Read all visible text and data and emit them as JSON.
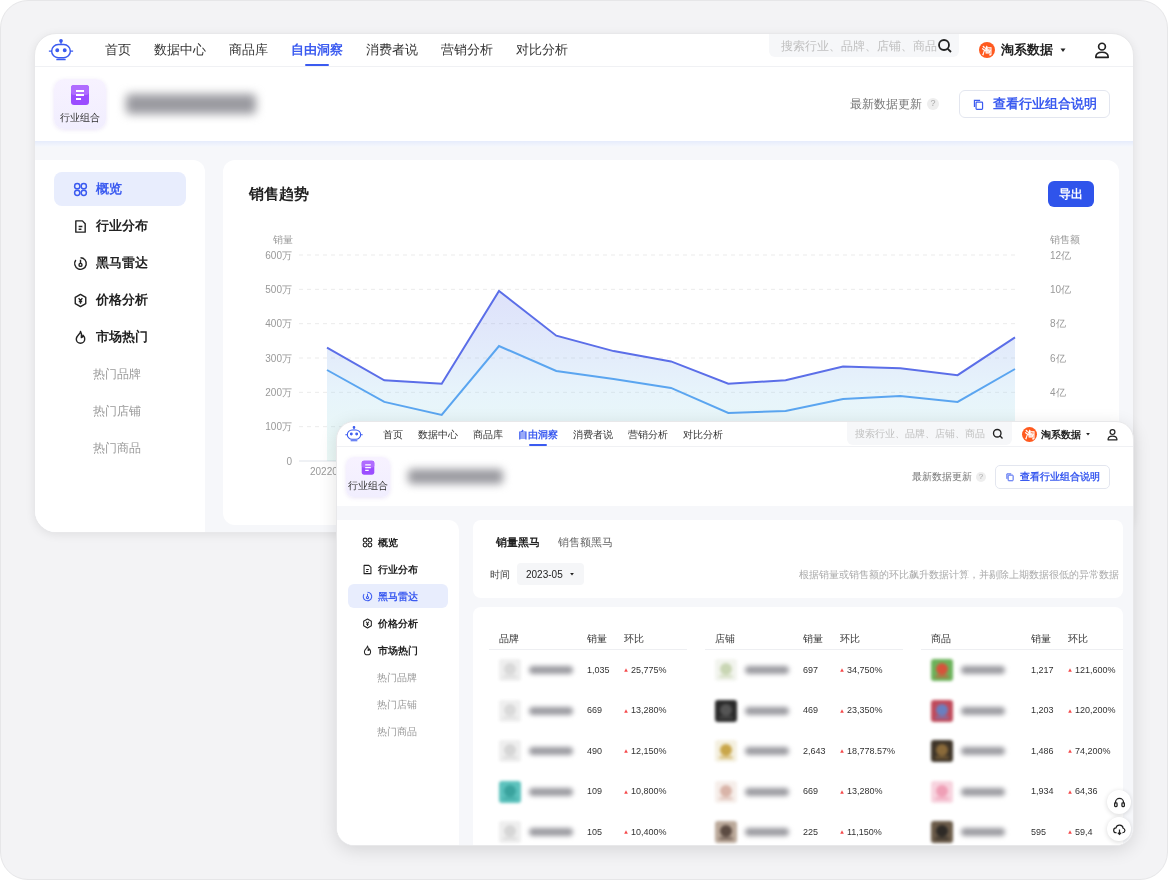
{
  "back_window": {
    "nav": {
      "items": [
        {
          "label": "首页",
          "selected": false
        },
        {
          "label": "数据中心",
          "selected": false
        },
        {
          "label": "商品库",
          "selected": false
        },
        {
          "label": "自由洞察",
          "selected": true
        },
        {
          "label": "消费者说",
          "selected": false
        },
        {
          "label": "营销分析",
          "selected": false
        },
        {
          "label": "对比分析",
          "selected": false
        }
      ],
      "search": {
        "placeholder": "搜索行业、品牌、店铺、商品"
      },
      "account": {
        "badge": "淘",
        "label": "淘系数据"
      }
    },
    "header": {
      "group_label": "行业组合",
      "update_label": "最新数据更新",
      "help": "?",
      "action": "查看行业组合说明"
    },
    "sidebar": {
      "items": [
        {
          "label": "概览",
          "kind": "grid",
          "selected": true
        },
        {
          "label": "行业分布",
          "kind": "doc",
          "selected": false
        },
        {
          "label": "黑马雷达",
          "kind": "radar",
          "selected": false
        },
        {
          "label": "价格分析",
          "kind": "price",
          "selected": false
        },
        {
          "label": "市场热门",
          "kind": "fire",
          "selected": false,
          "children": [
            {
              "label": "热门品牌",
              "selected": false
            },
            {
              "label": "热门店铺",
              "selected": false
            },
            {
              "label": "热门商品",
              "selected": false
            }
          ]
        }
      ]
    },
    "chart_card": {
      "title": "销售趋势",
      "export": "导出",
      "x_axis_label": "20220",
      "chart_data": {
        "type": "area",
        "grid": true,
        "ylabel": "销量",
        "ylim": [
          0,
          600
        ],
        "yticks": [
          {
            "value": 0,
            "label": "0"
          },
          {
            "value": 100,
            "label": "100万"
          },
          {
            "value": 200,
            "label": "200万"
          },
          {
            "value": 300,
            "label": "300万"
          },
          {
            "value": 400,
            "label": "400万"
          },
          {
            "value": 500,
            "label": "500万"
          },
          {
            "value": 600,
            "label": "600万"
          }
        ],
        "y2label": "销售额",
        "y2lim": [
          0,
          12
        ],
        "y2ticks": [
          {
            "value": 4,
            "label": "4亿"
          },
          {
            "value": 6,
            "label": "6亿"
          },
          {
            "value": 8,
            "label": "8亿"
          },
          {
            "value": 10,
            "label": "10亿"
          },
          {
            "value": 12,
            "label": "12亿"
          }
        ],
        "series": [
          {
            "color": "#5b6ee8",
            "axis": "y2",
            "values": [
              6.6,
              4.7,
              4.5,
              9.9,
              7.3,
              6.4,
              5.8,
              4.5,
              4.7,
              5.5,
              5.4,
              5.0,
              7.2
            ]
          },
          {
            "color": "#5aa5f0",
            "type": "line",
            "values": [
              265,
              172,
              134,
              335,
              262,
              239,
              213,
              140,
              146,
              181,
              189,
              172,
              268
            ]
          }
        ]
      }
    }
  },
  "front_window": {
    "nav": {
      "items": [
        {
          "label": "首页",
          "selected": false
        },
        {
          "label": "数据中心",
          "selected": false
        },
        {
          "label": "商品库",
          "selected": false
        },
        {
          "label": "自由洞察",
          "selected": true
        },
        {
          "label": "消费者说",
          "selected": false
        },
        {
          "label": "营销分析",
          "selected": false
        },
        {
          "label": "对比分析",
          "selected": false
        }
      ],
      "search": {
        "placeholder": "搜索行业、品牌、店铺、商品"
      },
      "account": {
        "badge": "淘",
        "label": "淘系数据"
      }
    },
    "header": {
      "group_label": "行业组合",
      "update_label": "最新数据更新",
      "help": "?",
      "action": "查看行业组合说明"
    },
    "sidebar": {
      "items": [
        {
          "label": "概览",
          "kind": "grid",
          "selected": false
        },
        {
          "label": "行业分布",
          "kind": "doc",
          "selected": false
        },
        {
          "label": "黑马雷达",
          "kind": "radar",
          "selected": true
        },
        {
          "label": "价格分析",
          "kind": "price",
          "selected": false
        },
        {
          "label": "市场热门",
          "kind": "fire",
          "selected": false,
          "children": [
            {
              "label": "热门品牌",
              "selected": false
            },
            {
              "label": "热门店铺",
              "selected": false
            },
            {
              "label": "热门商品",
              "selected": false
            }
          ]
        }
      ]
    },
    "tabs": [
      {
        "label": "销量黑马",
        "selected": true
      },
      {
        "label": "销售额黑马",
        "selected": false
      }
    ],
    "filter": {
      "label": "时间",
      "value": "2023-05"
    },
    "note": "根据销量或销售额的环比飙升数据计算，并剔除上期数据很低的异常数据",
    "table": {
      "groups": [
        {
          "columns": [
            "品牌",
            "销量",
            "环比"
          ],
          "rows": [
            {
              "sales": "1,035",
              "change": "25,775%"
            },
            {
              "sales": "669",
              "change": "13,280%"
            },
            {
              "sales": "490",
              "change": "12,150%"
            },
            {
              "sales": "109",
              "change": "10,800%"
            },
            {
              "sales": "105",
              "change": "10,400%"
            }
          ]
        },
        {
          "columns": [
            "店铺",
            "销量",
            "环比"
          ],
          "rows": [
            {
              "sales": "697",
              "change": "34,750%"
            },
            {
              "sales": "469",
              "change": "23,350%"
            },
            {
              "sales": "2,643",
              "change": "18,778.57%"
            },
            {
              "sales": "669",
              "change": "13,280%"
            },
            {
              "sales": "225",
              "change": "11,150%"
            }
          ]
        },
        {
          "columns": [
            "商品",
            "销量",
            "环比"
          ],
          "rows": [
            {
              "sales": "1,217",
              "change": "121,600%"
            },
            {
              "sales": "1,203",
              "change": "120,200%"
            },
            {
              "sales": "1,486",
              "change": "74,200%"
            },
            {
              "sales": "1,934",
              "change": "64,36"
            },
            {
              "sales": "595",
              "change": "59,4"
            }
          ]
        }
      ]
    }
  }
}
